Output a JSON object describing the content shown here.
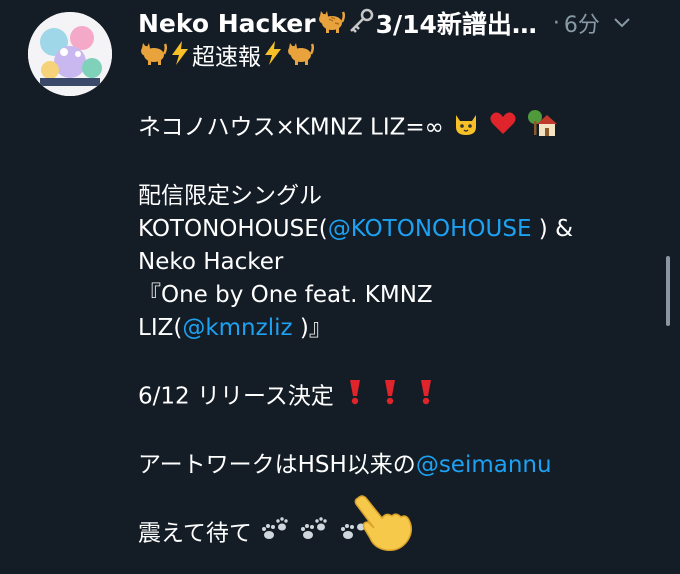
{
  "tweet": {
    "author_name": "Neko Hacker",
    "header_suffix": "3/14新譜出…",
    "separator": "·",
    "time": "6分",
    "line1": "超速報",
    "line2_text": "ネコノハウス×KMNZ LIZ=∞",
    "line3": "配信限定シングル",
    "line4_pre": "KOTONOHOUSE(",
    "line4_mention": "@KOTONOHOUSE",
    "line4_post": " ) &",
    "line5": "Neko Hacker",
    "line6": "『One by One feat. KMNZ",
    "line7_pre": "LIZ(",
    "line7_mention": "@kmnzliz",
    "line7_post": " )』",
    "line8_text": "6/12 リリース決定",
    "line9_pre": "アートワークはHSH以来の",
    "line9_mention": "@seimannu",
    "line10_text": "震えて待て"
  },
  "icons": {
    "cat": "cat-icon",
    "key": "key-icon",
    "lightning": "lightning-icon",
    "cat_face": "cat-face-icon",
    "heart": "red-heart-icon",
    "house": "house-with-tree-icon",
    "exclamation": "red-exclamation-icon",
    "paw": "paw-prints-icon",
    "hand": "pointing-hand-icon",
    "chevron": "chevron-down-icon"
  },
  "colors": {
    "background": "#141d26",
    "text": "#ffffff",
    "muted": "#8899a6",
    "mention": "#1da1f2"
  }
}
